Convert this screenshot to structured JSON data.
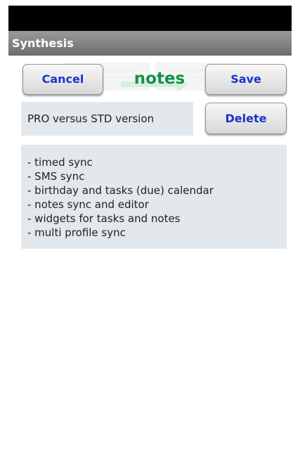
{
  "app": {
    "title": "Synthesis"
  },
  "header": {
    "screen_title": "notes",
    "cancel_label": "Cancel",
    "save_label": "Save",
    "title_color": "#149146",
    "button_text_color": "#1a35c9"
  },
  "note": {
    "subject": "PRO versus STD version",
    "delete_label": "Delete",
    "body_lines": [
      "- timed sync",
      "- SMS sync",
      "- birthday and tasks (due) calendar",
      "- notes sync and editor",
      "- widgets for tasks and notes",
      "- multi profile sync"
    ]
  }
}
